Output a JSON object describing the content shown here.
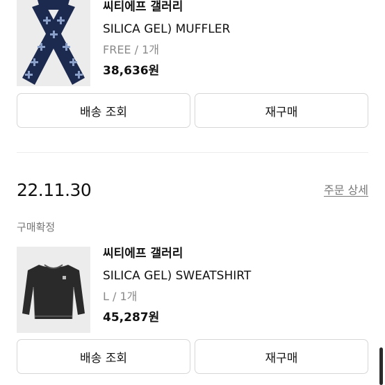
{
  "orders": [
    {
      "brand": "씨티에프 갤러리",
      "product_name": "SILICA GEL) MUFFLER",
      "option": "FREE / 1개",
      "price": "38,636원",
      "thumbnail": "muffler-image",
      "buttons": {
        "track": "배송 조회",
        "reorder": "재구매"
      }
    },
    {
      "date": "22.11.30",
      "detail_link": "주문 상세",
      "status": "구매확정",
      "brand": "씨티에프 갤러리",
      "product_name": "SILICA GEL) SWEATSHIRT",
      "option": "L / 1개",
      "price": "45,287원",
      "thumbnail": "sweatshirt-image",
      "buttons": {
        "track": "배송 조회",
        "reorder": "재구매"
      }
    }
  ],
  "colors": {
    "text": "#111111",
    "muted": "#8a8a8a",
    "link": "#777777",
    "button_border": "#d6d6d6",
    "thumb_bg": "#ececec",
    "muffler": "#1d2a4f",
    "sweatshirt": "#2a2a2a"
  }
}
